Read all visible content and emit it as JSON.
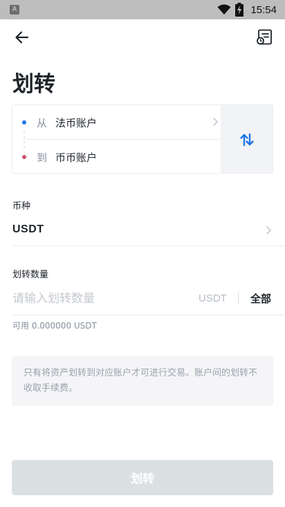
{
  "status_bar": {
    "app_icon_letter": "A",
    "time": "15:54",
    "icons": [
      "wifi-icon",
      "battery-charging-icon"
    ]
  },
  "header": {
    "back_icon": "arrow-left-icon",
    "records_icon": "transfer-records-icon"
  },
  "page": {
    "title": "划转"
  },
  "transfer": {
    "from_prefix": "从",
    "from_account": "法币账户",
    "to_prefix": "到",
    "to_account": "币币账户",
    "swap_icon": "swap-vertical-icon"
  },
  "coin": {
    "label": "币种",
    "value": "USDT"
  },
  "amount": {
    "label": "划转数量",
    "placeholder": "请输入划转数量",
    "value": "",
    "unit": "USDT",
    "all_label": "全部",
    "available": "可用 0.000000 USDT"
  },
  "notice": {
    "text": "只有将资产划转到对应账户才可进行交易。账户间的划转不收取手续费。"
  },
  "submit": {
    "label": "划转"
  },
  "colors": {
    "from_dot": "#1e74e8",
    "to_dot": "#c9556d",
    "swap_icon": "#1e74e8",
    "button_disabled": "#dbe0e3"
  }
}
